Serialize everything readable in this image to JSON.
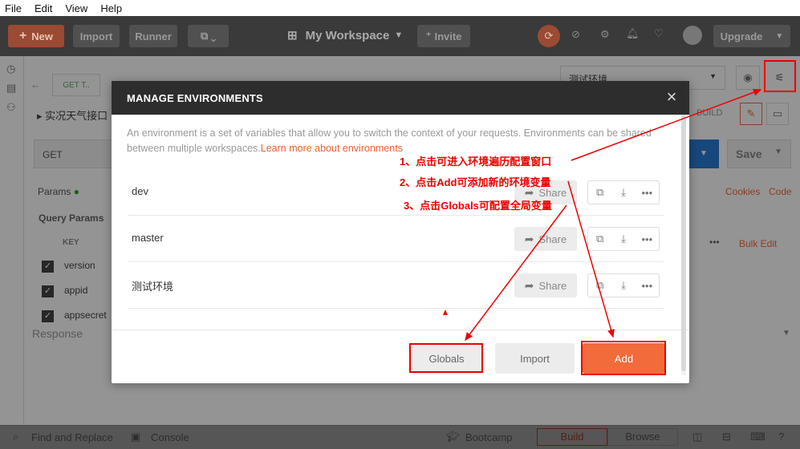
{
  "menubar": {
    "items": [
      "File",
      "Edit",
      "View",
      "Help"
    ]
  },
  "header": {
    "new_label": "New",
    "import_label": "Import",
    "runner_label": "Runner",
    "workspace_label": "My Workspace",
    "invite_label": "Invite",
    "upgrade_label": "Upgrade"
  },
  "background": {
    "tab_label": "GET T..",
    "request_name": "实况天气接口",
    "method": "GET",
    "params_tab": "Params",
    "query_params": "Query Params",
    "key_header": "KEY",
    "params": [
      "version",
      "appid",
      "appsecret"
    ],
    "response_label": "Response",
    "env_select": "测试环境",
    "build_label": "BUILD",
    "save_label": "Save",
    "cookies_label": "Cookies",
    "code_label": "Code",
    "bulk_edit": "Bulk Edit"
  },
  "modal": {
    "title": "MANAGE ENVIRONMENTS",
    "description": "An environment is a set of variables that allow you to switch the context of your requests. Environments can be shared between multiple workspaces.",
    "learn_more": "Learn more about environments",
    "share_label": "Share",
    "environments": [
      "dev",
      "master",
      "测试环境"
    ],
    "globals_label": "Globals",
    "import_label": "Import",
    "add_label": "Add"
  },
  "annotations": {
    "note1": "1、点击可进入环境遍历配置窗口",
    "note2": "2、点击Add可添加新的环境变量",
    "note3": "3、点击Globals可配置全局变量"
  },
  "statusbar": {
    "find_replace": "Find and Replace",
    "console": "Console",
    "bootcamp": "Bootcamp",
    "build": "Build",
    "browse": "Browse"
  },
  "colors": {
    "accent": "#f26b3a",
    "annotation": "#e00000",
    "header_bg": "#3a3a3a",
    "modal_header_bg": "#2d2d2d"
  }
}
